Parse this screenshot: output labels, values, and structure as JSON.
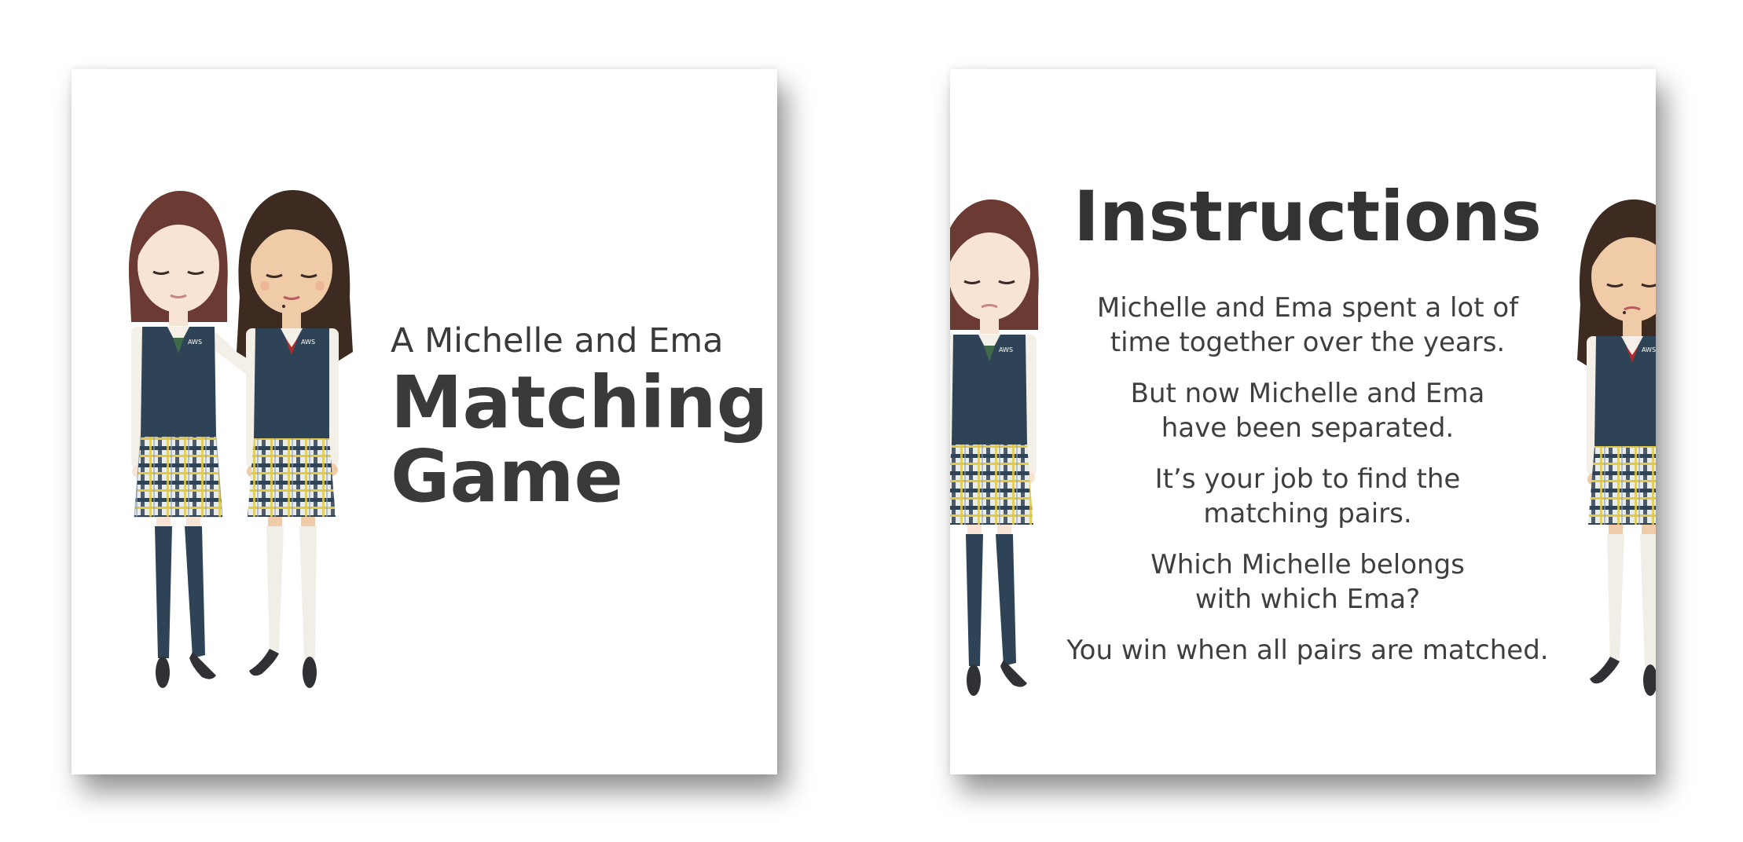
{
  "title_card": {
    "subtitle": "A Michelle and Ema",
    "title_line1": "Matching",
    "title_line2": "Game",
    "badge_text": "AWS"
  },
  "instructions_card": {
    "heading": "Instructions",
    "paragraphs": [
      {
        "line1": "Michelle and Ema spent a lot of",
        "line2": "time together over the years."
      },
      {
        "line1": "But now Michelle and Ema",
        "line2": "have been separated."
      },
      {
        "line1": "It’s your job to find the",
        "line2": "matching pairs."
      },
      {
        "line1": "Which Michelle belongs",
        "line2": "with which Ema?"
      },
      {
        "line1": "You win when all pairs are matched.",
        "line2": ""
      }
    ]
  },
  "colors": {
    "text": "#3a3a3a",
    "vest": "#2f4356",
    "michelle_hair": "#6b3a32",
    "ema_hair": "#3d2b22",
    "skin_light": "#f7e4d4",
    "skin_tan": "#f0cba7",
    "michelle_tie": "#3f6b4a",
    "ema_tie": "#b22a2e"
  }
}
